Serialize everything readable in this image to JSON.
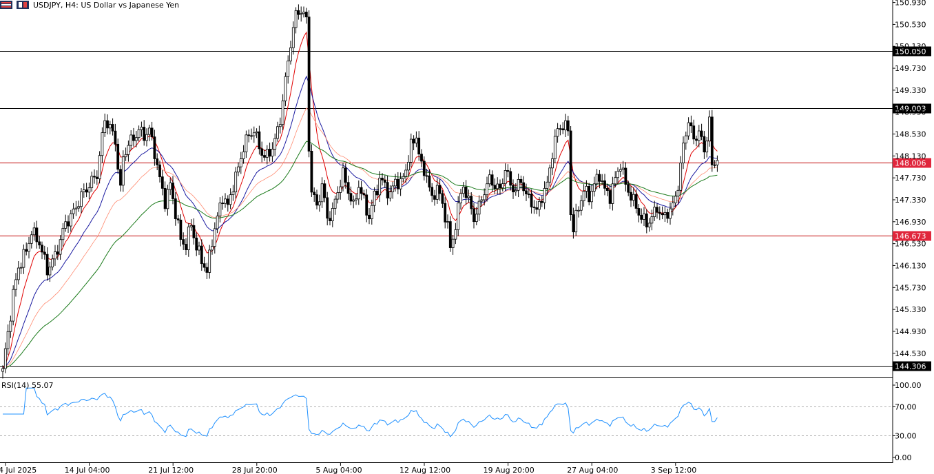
{
  "header": {
    "symbol": "USDJPY",
    "timeframe": "H4",
    "description": "US Dollar vs Japanese Yen",
    "title_text": "USDJPY, H4:  US Dollar vs Japanese Yen"
  },
  "icons": [
    "chart-menu-icon",
    "one-click-trading-icon"
  ],
  "colors": {
    "candle": "#000000",
    "ema_fast": "#e00000",
    "ma_blue": "#1a1aa0",
    "ma_salmon": "#ff8a70",
    "ma_green": "#1a7a1a",
    "h_line_black": "#000000",
    "h_line_red": "#c00000",
    "rsi_line": "#1e90ff",
    "label_red_bg": "#e0263c",
    "label_black_bg": "#000000"
  },
  "chart_data": {
    "type": "candlestick",
    "symbol": "USDJPY",
    "timeframe": "H4",
    "price_range": [
      144.15,
      150.95
    ],
    "y_tick_labels": [
      "150.930",
      "150.530",
      "150.130",
      "149.730",
      "149.330",
      "148.930",
      "148.530",
      "148.130",
      "147.730",
      "147.330",
      "146.930",
      "146.530",
      "146.130",
      "145.730",
      "145.330",
      "144.930",
      "144.530"
    ],
    "x_tick_labels": [
      "4 Jul 2025",
      "14 Jul 04:00",
      "21 Jul 12:00",
      "28 Jul 20:00",
      "5 Aug 04:00",
      "12 Aug 12:00",
      "19 Aug 20:00",
      "27 Aug 04:00",
      "3 Sep 12:00"
    ],
    "x_tick_positions_bar": [
      0,
      32,
      64,
      96,
      128,
      160,
      192,
      224,
      256
    ],
    "horizontal_levels": [
      {
        "price": 150.05,
        "label": "150.050",
        "style": "black"
      },
      {
        "price": 149.003,
        "label": "149.003",
        "style": "black"
      },
      {
        "price": 148.006,
        "label": "148.006",
        "style": "red"
      },
      {
        "price": 146.673,
        "label": "146.673",
        "style": "red"
      },
      {
        "price": 144.306,
        "label": "144.306",
        "style": "black"
      }
    ],
    "close_anchors": [
      [
        0,
        144.25
      ],
      [
        2,
        144.9
      ],
      [
        4,
        145.6
      ],
      [
        6,
        146.1
      ],
      [
        9,
        146.4
      ],
      [
        11,
        146.75
      ],
      [
        14,
        146.55
      ],
      [
        17,
        146.05
      ],
      [
        20,
        146.3
      ],
      [
        24,
        146.9
      ],
      [
        27,
        147.1
      ],
      [
        30,
        147.4
      ],
      [
        33,
        147.6
      ],
      [
        36,
        147.8
      ],
      [
        39,
        148.8
      ],
      [
        41,
        148.65
      ],
      [
        43,
        148.4
      ],
      [
        45,
        147.5
      ],
      [
        46,
        148.1
      ],
      [
        48,
        148.35
      ],
      [
        50,
        148.45
      ],
      [
        52,
        148.6
      ],
      [
        54,
        148.5
      ],
      [
        56,
        148.6
      ],
      [
        58,
        148.2
      ],
      [
        60,
        147.7
      ],
      [
        62,
        147.3
      ],
      [
        64,
        147.6
      ],
      [
        66,
        147.1
      ],
      [
        68,
        146.6
      ],
      [
        70,
        146.5
      ],
      [
        72,
        146.9
      ],
      [
        74,
        146.45
      ],
      [
        76,
        146.25
      ],
      [
        78,
        146.0
      ],
      [
        80,
        146.6
      ],
      [
        82,
        147.0
      ],
      [
        84,
        147.4
      ],
      [
        86,
        147.2
      ],
      [
        88,
        147.6
      ],
      [
        90,
        147.9
      ],
      [
        92,
        148.3
      ],
      [
        94,
        148.5
      ],
      [
        96,
        148.6
      ],
      [
        98,
        148.3
      ],
      [
        100,
        148.1
      ],
      [
        102,
        148.2
      ],
      [
        104,
        148.4
      ],
      [
        106,
        148.8
      ],
      [
        108,
        149.5
      ],
      [
        110,
        150.2
      ],
      [
        112,
        150.7
      ],
      [
        114,
        150.8
      ],
      [
        116,
        150.6
      ],
      [
        117,
        148.3
      ],
      [
        118,
        147.5
      ],
      [
        120,
        147.2
      ],
      [
        122,
        147.6
      ],
      [
        124,
        147.0
      ],
      [
        126,
        147.1
      ],
      [
        128,
        147.5
      ],
      [
        130,
        147.8
      ],
      [
        132,
        147.5
      ],
      [
        134,
        147.2
      ],
      [
        136,
        147.6
      ],
      [
        138,
        147.3
      ],
      [
        140,
        147.0
      ],
      [
        142,
        147.4
      ],
      [
        144,
        147.7
      ],
      [
        146,
        147.6
      ],
      [
        148,
        147.4
      ],
      [
        150,
        147.7
      ],
      [
        152,
        147.6
      ],
      [
        154,
        147.9
      ],
      [
        156,
        148.3
      ],
      [
        158,
        148.5
      ],
      [
        160,
        147.9
      ],
      [
        162,
        147.8
      ],
      [
        164,
        147.3
      ],
      [
        166,
        147.6
      ],
      [
        168,
        147.2
      ],
      [
        170,
        146.9
      ],
      [
        171,
        146.4
      ],
      [
        172,
        146.6
      ],
      [
        174,
        147.2
      ],
      [
        176,
        147.6
      ],
      [
        178,
        147.3
      ],
      [
        180,
        147.0
      ],
      [
        182,
        147.2
      ],
      [
        184,
        147.5
      ],
      [
        186,
        147.7
      ],
      [
        188,
        147.6
      ],
      [
        190,
        147.5
      ],
      [
        192,
        147.9
      ],
      [
        194,
        147.6
      ],
      [
        196,
        147.5
      ],
      [
        198,
        147.7
      ],
      [
        200,
        147.4
      ],
      [
        202,
        147.3
      ],
      [
        204,
        147.1
      ],
      [
        206,
        147.4
      ],
      [
        208,
        147.6
      ],
      [
        210,
        148.2
      ],
      [
        212,
        148.6
      ],
      [
        214,
        148.7
      ],
      [
        216,
        148.6
      ],
      [
        217,
        147.1
      ],
      [
        218,
        146.8
      ],
      [
        220,
        147.2
      ],
      [
        222,
        147.5
      ],
      [
        224,
        147.4
      ],
      [
        226,
        147.6
      ],
      [
        228,
        147.8
      ],
      [
        230,
        147.5
      ],
      [
        232,
        147.4
      ],
      [
        234,
        147.7
      ],
      [
        236,
        148.0
      ],
      [
        238,
        147.6
      ],
      [
        240,
        147.4
      ],
      [
        242,
        147.2
      ],
      [
        244,
        147.0
      ],
      [
        246,
        146.9
      ],
      [
        248,
        147.0
      ],
      [
        250,
        147.2
      ],
      [
        252,
        147.0
      ],
      [
        254,
        147.1
      ],
      [
        256,
        147.2
      ],
      [
        258,
        147.6
      ],
      [
        260,
        148.3
      ],
      [
        262,
        148.8
      ],
      [
        264,
        148.4
      ],
      [
        266,
        148.6
      ],
      [
        268,
        148.2
      ],
      [
        270,
        148.8
      ],
      [
        271,
        147.9
      ],
      [
        272,
        148.0
      ],
      [
        273,
        148.05
      ]
    ],
    "moving_averages": [
      {
        "type": "EMA",
        "period": "fast",
        "color": "red"
      },
      {
        "type": "MA",
        "period": "medium",
        "color": "blue"
      },
      {
        "type": "MA",
        "period": "slow",
        "color": "salmon"
      },
      {
        "type": "MA",
        "period": "long",
        "color": "green"
      }
    ],
    "rsi": {
      "label": "RSI(14) 55.07",
      "period": 14,
      "value": 55.07,
      "range": [
        0,
        100
      ],
      "levels": [
        30,
        70
      ],
      "y_tick_labels": [
        "100.00",
        "70.00",
        "30.00",
        "0.00"
      ]
    },
    "grid": false
  }
}
